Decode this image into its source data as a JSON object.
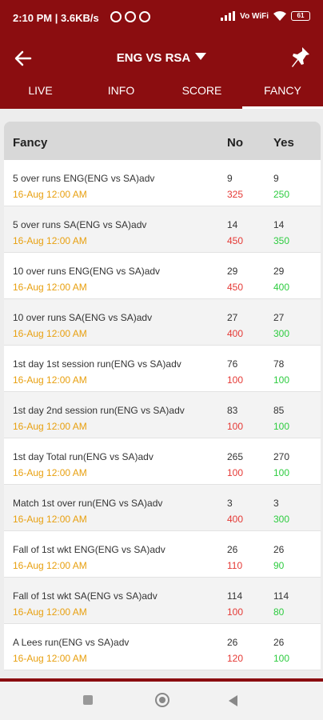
{
  "status_bar": {
    "time": "2:10 PM | 3.6KB/s",
    "network": "Vo WiFi",
    "battery": "61"
  },
  "header": {
    "title": "ENG VS RSA"
  },
  "tabs": [
    {
      "label": "LIVE",
      "active": false
    },
    {
      "label": "INFO",
      "active": false
    },
    {
      "label": "SCORE",
      "active": false
    },
    {
      "label": "FANCY",
      "active": true
    }
  ],
  "table": {
    "headers": {
      "name": "Fancy",
      "no": "No",
      "yes": "Yes"
    },
    "rows": [
      {
        "name": "5 over runs ENG(ENG vs SA)adv",
        "date": "16-Aug 12:00 AM",
        "no": "9",
        "no_size": "325",
        "yes": "9",
        "yes_size": "250"
      },
      {
        "name": "5 over runs SA(ENG vs SA)adv",
        "date": "16-Aug 12:00 AM",
        "no": "14",
        "no_size": "450",
        "yes": "14",
        "yes_size": "350"
      },
      {
        "name": "10 over runs ENG(ENG vs SA)adv",
        "date": "16-Aug 12:00 AM",
        "no": "29",
        "no_size": "450",
        "yes": "29",
        "yes_size": "400"
      },
      {
        "name": "10 over runs SA(ENG vs SA)adv",
        "date": "16-Aug 12:00 AM",
        "no": "27",
        "no_size": "400",
        "yes": "27",
        "yes_size": "300"
      },
      {
        "name": "1st day 1st session run(ENG vs SA)adv",
        "date": "16-Aug 12:00 AM",
        "no": "76",
        "no_size": "100",
        "yes": "78",
        "yes_size": "100"
      },
      {
        "name": "1st day 2nd session run(ENG vs SA)adv",
        "date": "16-Aug 12:00 AM",
        "no": "83",
        "no_size": "100",
        "yes": "85",
        "yes_size": "100"
      },
      {
        "name": "1st day Total run(ENG vs SA)adv",
        "date": "16-Aug 12:00 AM",
        "no": "265",
        "no_size": "100",
        "yes": "270",
        "yes_size": "100"
      },
      {
        "name": "Match 1st over run(ENG vs SA)adv",
        "date": "16-Aug 12:00 AM",
        "no": "3",
        "no_size": "400",
        "yes": "3",
        "yes_size": "300"
      },
      {
        "name": "Fall of 1st wkt ENG(ENG vs SA)adv",
        "date": "16-Aug 12:00 AM",
        "no": "26",
        "no_size": "110",
        "yes": "26",
        "yes_size": "90"
      },
      {
        "name": "Fall of 1st wkt SA(ENG vs SA)adv",
        "date": "16-Aug 12:00 AM",
        "no": "114",
        "no_size": "100",
        "yes": "114",
        "yes_size": "80"
      },
      {
        "name": "A Lees run(ENG vs SA)adv",
        "date": "16-Aug 12:00 AM",
        "no": "26",
        "no_size": "120",
        "yes": "26",
        "yes_size": "100"
      }
    ]
  },
  "colors": {
    "brand": "#8b0d10",
    "date": "#e8a010",
    "no": "#e53935",
    "yes": "#2ecc40"
  }
}
